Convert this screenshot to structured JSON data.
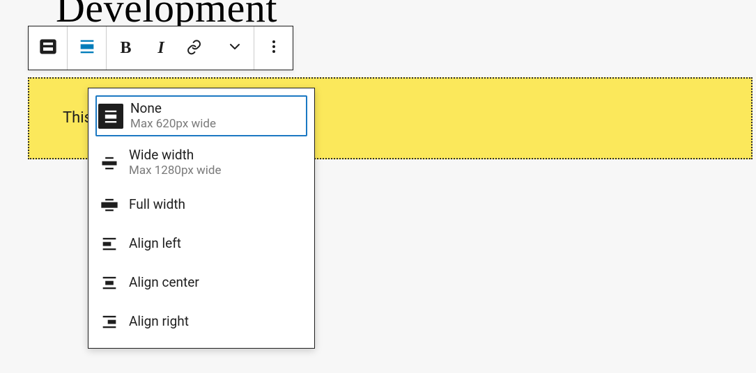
{
  "page": {
    "title": "Development"
  },
  "block": {
    "text": "This"
  },
  "toolbar": {
    "block_type_icon": "group-block",
    "align_icon": "align-none",
    "bold_label": "B",
    "italic_label": "I"
  },
  "align_menu": {
    "items": [
      {
        "label": "None",
        "desc": "Max 620px wide",
        "icon": "align-none-boxed",
        "selected": true
      },
      {
        "label": "Wide width",
        "desc": "Max 1280px wide",
        "icon": "align-wide",
        "selected": false
      },
      {
        "label": "Full width",
        "desc": "",
        "icon": "align-full",
        "selected": false
      },
      {
        "label": "Align left",
        "desc": "",
        "icon": "align-left",
        "selected": false
      },
      {
        "label": "Align center",
        "desc": "",
        "icon": "align-center",
        "selected": false
      },
      {
        "label": "Align right",
        "desc": "",
        "icon": "align-right",
        "selected": false
      }
    ]
  }
}
